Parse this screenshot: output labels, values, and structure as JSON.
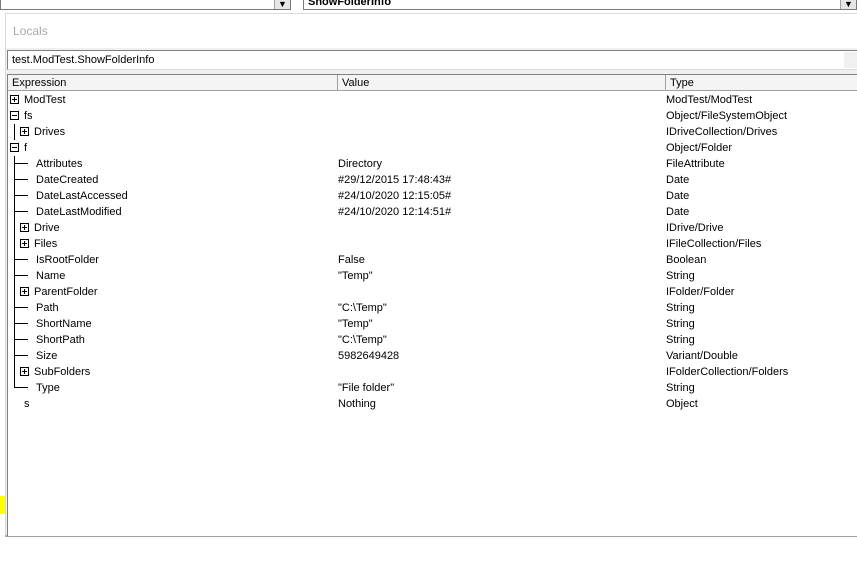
{
  "editor": {
    "object_combo": "",
    "procedure_combo": "ShowFolderInfo",
    "dropdown_glyph": "▼"
  },
  "window": {
    "title": "Locals",
    "context": "test.ModTest.ShowFolderInfo"
  },
  "columns": {
    "expression": "Expression",
    "value": "Value",
    "type": "Type"
  },
  "rows": [
    {
      "expression": "ModTest",
      "value": "",
      "type": "ModTest/ModTest",
      "expander": "plus"
    },
    {
      "expression": "fs",
      "value": "",
      "type": "Object/FileSystemObject",
      "expander": "minus"
    },
    {
      "expression": "Drives",
      "value": "",
      "type": "IDriveCollection/Drives",
      "expander": "plus"
    },
    {
      "expression": "f",
      "value": "",
      "type": "Object/Folder",
      "expander": "minus"
    },
    {
      "expression": "Attributes",
      "value": "Directory",
      "type": "FileAttribute",
      "expander": "none"
    },
    {
      "expression": "DateCreated",
      "value": "#29/12/2015 17:48:43#",
      "type": "Date",
      "expander": "none"
    },
    {
      "expression": "DateLastAccessed",
      "value": "#24/10/2020 12:15:05#",
      "type": "Date",
      "expander": "none"
    },
    {
      "expression": "DateLastModified",
      "value": "#24/10/2020 12:14:51#",
      "type": "Date",
      "expander": "none"
    },
    {
      "expression": "Drive",
      "value": "",
      "type": "IDrive/Drive",
      "expander": "plus"
    },
    {
      "expression": "Files",
      "value": "",
      "type": "IFileCollection/Files",
      "expander": "plus"
    },
    {
      "expression": "IsRootFolder",
      "value": "False",
      "type": "Boolean",
      "expander": "none"
    },
    {
      "expression": "Name",
      "value": "\"Temp\"",
      "type": "String",
      "expander": "none"
    },
    {
      "expression": "ParentFolder",
      "value": "",
      "type": "IFolder/Folder",
      "expander": "plus"
    },
    {
      "expression": "Path",
      "value": "\"C:\\Temp\"",
      "type": "String",
      "expander": "none"
    },
    {
      "expression": "ShortName",
      "value": "\"Temp\"",
      "type": "String",
      "expander": "none"
    },
    {
      "expression": "ShortPath",
      "value": "\"C:\\Temp\"",
      "type": "String",
      "expander": "none"
    },
    {
      "expression": "Size",
      "value": "5982649428",
      "type": "Variant/Double",
      "expander": "none"
    },
    {
      "expression": "SubFolders",
      "value": "",
      "type": "IFolderCollection/Folders",
      "expander": "plus"
    },
    {
      "expression": "Type",
      "value": "\"File folder\"",
      "type": "String",
      "expander": "none"
    },
    {
      "expression": "s",
      "value": "Nothing",
      "type": "Object",
      "expander": "none"
    }
  ]
}
